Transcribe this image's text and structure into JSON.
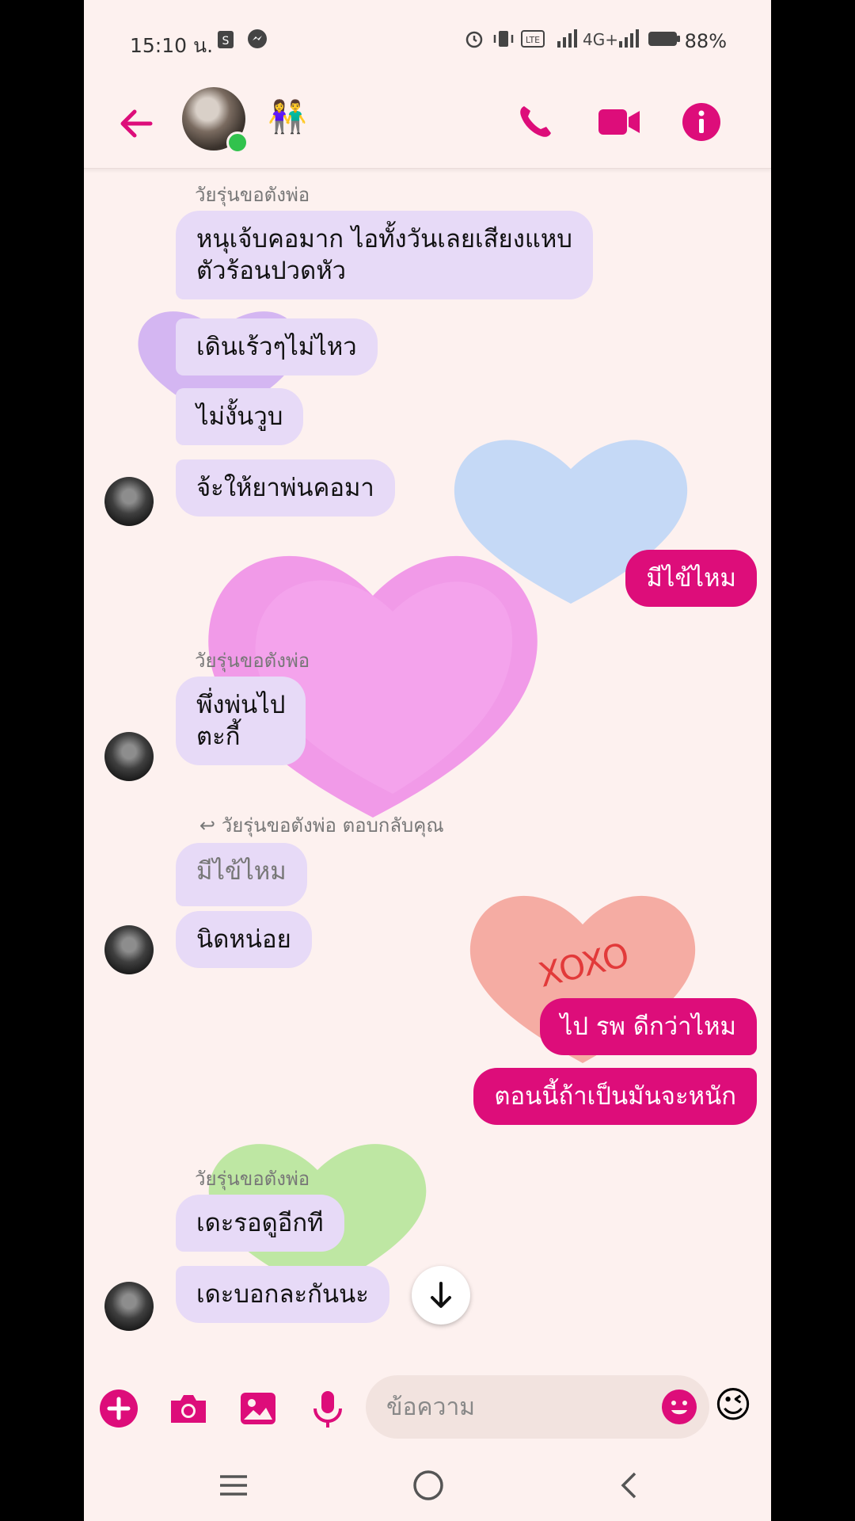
{
  "status_bar": {
    "time": "15:10 น.",
    "network": "4G+",
    "battery": "88%"
  },
  "header": {
    "back_icon": "arrow-left-icon",
    "group_emoji": "👫",
    "call_icon": "phone-icon",
    "video_icon": "video-camera-icon",
    "info_icon": "info-icon",
    "accent_color": "#dd0d7a"
  },
  "messages": {
    "sender_name_1": "วัยรุ่นขอตังพ่อ",
    "in_1_line1": "หนุเจ้บคอมาก ไอทั้งวันเลยเสียงแหบ",
    "in_1_line2": "ตัวร้อนปวดหัว",
    "in_2": "เดินเร้วๆไม่ไหว",
    "in_3": "ไม่งั้นวูบ",
    "in_4": "จ้ะให้ยาพ่นคอมา",
    "out_1": "มีไข้ไหม",
    "sender_name_2": "วัยรุ่นขอตังพ่อ",
    "in_5_line1": "พึ่งพ่นไป",
    "in_5_line2": "ตะกี้",
    "reply_label": "วัยรุ่นขอตังพ่อ ตอบกลับคุณ",
    "quoted": "มีไข้ไหม",
    "in_6": "นิดหน่อย",
    "out_2": "ไป รพ ดีกว่าไหม",
    "out_3": "ตอนนี้ถ้าเป็นมันจะหนัก",
    "sender_name_3": "วัยรุ่นขอตังพ่อ",
    "in_7": "เดะรอดูอีกที",
    "in_8": "เดะบอกละกันนะ",
    "heart_text": "XOXO"
  },
  "composer": {
    "placeholder": "ข้อความ",
    "wink_emoji": "😉"
  },
  "colors": {
    "outgoing_bubble": "#dd0d7a",
    "incoming_bubble": "#e7daf7",
    "background": "#fdf1ef"
  }
}
